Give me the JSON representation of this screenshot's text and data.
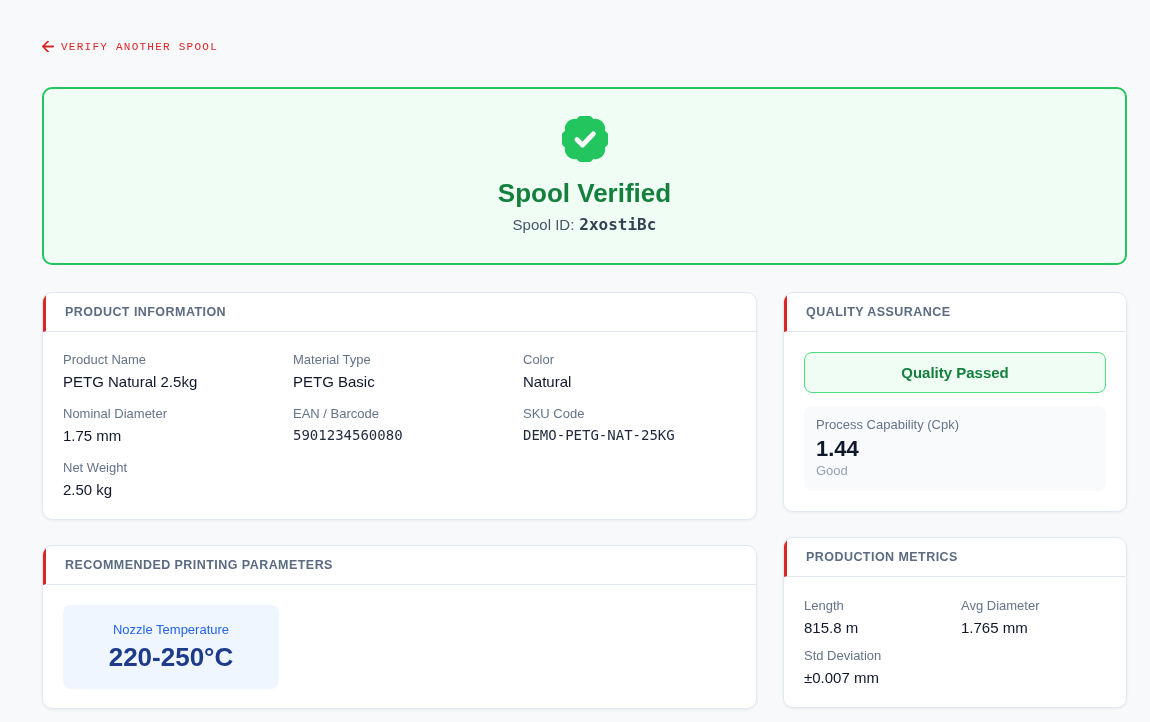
{
  "back_link": {
    "label": "VERIFY ANOTHER SPOOL"
  },
  "verification": {
    "verified": true,
    "title": "Spool Verified",
    "id_label": "Spool ID:",
    "spool_id": "2xostiBc"
  },
  "product_information": {
    "title": "PRODUCT INFORMATION",
    "fields": [
      {
        "label": "Product Name",
        "value": "PETG Natural 2.5kg",
        "kind": "text"
      },
      {
        "label": "Material Type",
        "value": "PETG Basic",
        "kind": "text"
      },
      {
        "label": "Color",
        "value": "Natural",
        "kind": "text"
      },
      {
        "label": "Nominal Diameter",
        "value": "1.75 mm",
        "kind": "text"
      },
      {
        "label": "EAN / Barcode",
        "value": "5901234560080",
        "kind": "code"
      },
      {
        "label": "SKU Code",
        "value": "DEMO-PETG-NAT-25KG",
        "kind": "code"
      },
      {
        "label": "Net Weight",
        "value": "2.50 kg",
        "kind": "text"
      }
    ]
  },
  "quality_assurance": {
    "title": "QUALITY ASSURANCE",
    "result": {
      "label": "Quality Passed",
      "passed": true
    },
    "cpk": {
      "label": "Process Capability (Cpk)",
      "value": "1.44",
      "rating": "Good"
    }
  },
  "printing_parameters": {
    "title": "RECOMMENDED PRINTING PARAMETERS",
    "params": [
      {
        "label": "Nozzle Temperature",
        "value": "220-250°C"
      }
    ]
  },
  "production_metrics": {
    "title": "PRODUCTION METRICS",
    "fields": [
      {
        "label": "Length",
        "value": "815.8 m"
      },
      {
        "label": "Avg Diameter",
        "value": "1.765 mm"
      },
      {
        "label": "Std Deviation",
        "value": "±0.007 mm"
      }
    ]
  }
}
